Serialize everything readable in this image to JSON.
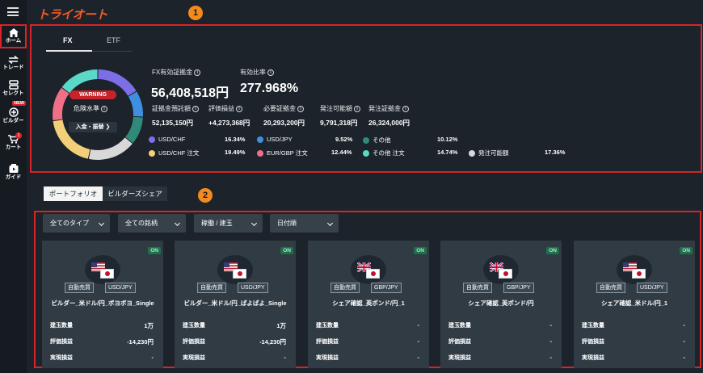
{
  "sidebar": {
    "items": [
      {
        "label": "ホーム",
        "icon": "home-icon"
      },
      {
        "label": "トレード",
        "icon": "trade-icon"
      },
      {
        "label": "セレクト",
        "icon": "select-icon"
      },
      {
        "label": "ビルダー",
        "icon": "builder-icon",
        "badge": "NEW"
      },
      {
        "label": "カート",
        "icon": "cart-icon",
        "badge": "1"
      },
      {
        "label": "ガイド",
        "icon": "guide-icon"
      }
    ]
  },
  "header": {
    "logo": "トライオート"
  },
  "markers": [
    "1",
    "2"
  ],
  "summary": {
    "tabs": [
      "FX",
      "ETF"
    ],
    "warning": "WARNING",
    "danger_label": "危険水準",
    "deposit_button": "入金・振替 ❯",
    "effective_margin_label": "FX有効証拠金",
    "effective_margin_value": "56,408,518円",
    "effective_ratio_label": "有効比率",
    "effective_ratio_value": "277.968%",
    "metrics": [
      {
        "label": "証拠金預託額",
        "value": "52,135,150円"
      },
      {
        "label": "評価損益",
        "value": "+4,273,368円"
      },
      {
        "label": "必要証拠金",
        "value": "20,293,200円"
      },
      {
        "label": "発注可能額",
        "value": "9,791,318円"
      },
      {
        "label": "発注証拠金",
        "value": "26,324,000円"
      }
    ],
    "legend": [
      {
        "label": "USD/CHF",
        "value": "16.34%",
        "color": "#7b6ee6"
      },
      {
        "label": "USD/JPY",
        "value": "9.52%",
        "color": "#3f8fe0"
      },
      {
        "label": "その他",
        "value": "10.12%",
        "color": "#2f8a7a"
      },
      {
        "label": "USD/CHF 注文",
        "value": "19.49%",
        "color": "#f3cf7a"
      },
      {
        "label": "EUR/GBP 注文",
        "value": "12.44%",
        "color": "#ee6f86"
      },
      {
        "label": "その他 注文",
        "value": "14.74%",
        "color": "#5ad8c8"
      },
      {
        "label": "発注可能額",
        "value": "17.36%",
        "color": "#d8d8d8"
      }
    ]
  },
  "portfolio": {
    "tabs": [
      "ポートフォリオ",
      "ビルダーズシェア"
    ],
    "filters": [
      "全てのタイプ",
      "全ての銘柄",
      "稼働 / 建玉",
      "日付順"
    ],
    "row_labels": [
      "建玉数量",
      "評価損益",
      "実現損益"
    ],
    "cards": [
      {
        "status": "ON",
        "type": "自動売買",
        "pair": "USD/JPY",
        "title": "ビルダー_米ドル/円_ボヨボヨ_Single",
        "position": "1万",
        "pl": "-14,230円",
        "realized": "-",
        "flag": "us"
      },
      {
        "status": "ON",
        "type": "自動売買",
        "pair": "USD/JPY",
        "title": "ビルダー_米ドル/円_ぱよぱよ_Single",
        "position": "1万",
        "pl": "-14,230円",
        "realized": "-",
        "flag": "us"
      },
      {
        "status": "ON",
        "type": "自動売買",
        "pair": "GBP/JPY",
        "title": "シェア確認_英ポンド/円_1",
        "position": "-",
        "pl": "-",
        "realized": "-",
        "flag": "uk"
      },
      {
        "status": "ON",
        "type": "自動売買",
        "pair": "GBP/JPY",
        "title": "シェア確認_英ポンド/円",
        "position": "-",
        "pl": "-",
        "realized": "-",
        "flag": "uk"
      },
      {
        "status": "ON",
        "type": "自動売買",
        "pair": "USD/JPY",
        "title": "シェア確認_米ドル/円_1",
        "position": "-",
        "pl": "-",
        "realized": "-",
        "flag": "us"
      }
    ]
  }
}
